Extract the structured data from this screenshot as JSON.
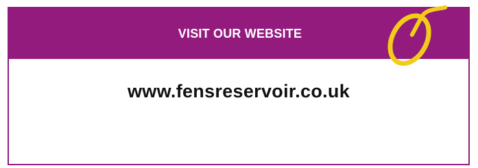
{
  "banner": {
    "title": "VISIT OUR WEBSITE",
    "url": "www.fensreservoir.co.uk",
    "icon": "computer-mouse-icon"
  },
  "colors": {
    "brand_purple": "#931b7e",
    "icon_yellow": "#f3cc1a",
    "text_dark": "#111111"
  }
}
